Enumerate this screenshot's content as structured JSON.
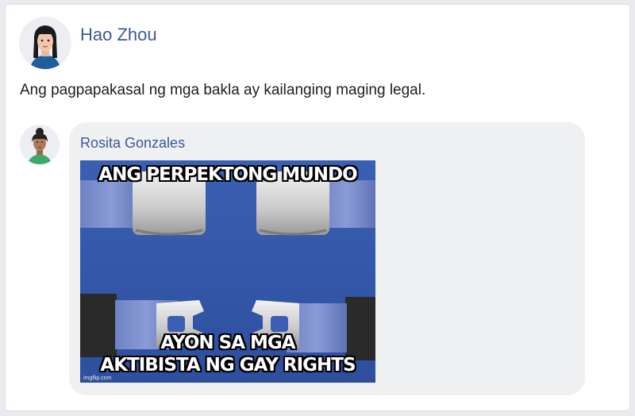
{
  "post": {
    "author": "Hao Zhou",
    "text": "Ang pagpapakasal ng mga bakla ay kailanging maging legal."
  },
  "comment": {
    "author": "Rosita Gonzales",
    "meme": {
      "top_text": "ANG PERPEKTONG MUNDO",
      "bottom_line1": "AYON SA MGA",
      "bottom_line2": "AKTIBISTA NG GAY RIGHTS",
      "watermark": "imgflip.com"
    }
  },
  "icons": {
    "post_avatar": "woman-avatar-icon",
    "comment_avatar": "woman-avatar-icon"
  },
  "colors": {
    "link_blue": "#3b5998",
    "bubble_bg": "#eff0f2",
    "meme_bg": "#3455a8"
  }
}
